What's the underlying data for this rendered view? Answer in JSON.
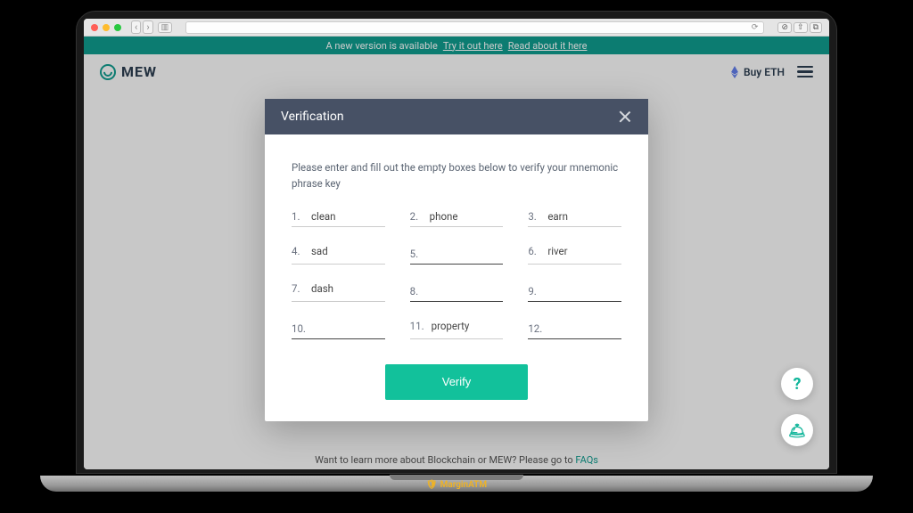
{
  "domain": "Computer-Use",
  "browser": {
    "reader_hint": "⤢"
  },
  "banner": {
    "text": "A new version is available",
    "link1": "Try it out here",
    "link2": "Read about it here"
  },
  "header": {
    "logo_text": "MEW",
    "buy_eth": "Buy ETH"
  },
  "modal": {
    "title": "Verification",
    "instruction": "Please enter and fill out the empty boxes below to verify your mnemonic phrase key",
    "words": [
      {
        "n": "1.",
        "v": "clean",
        "dark": false
      },
      {
        "n": "2.",
        "v": "phone",
        "dark": false
      },
      {
        "n": "3.",
        "v": "earn",
        "dark": false
      },
      {
        "n": "4.",
        "v": "sad",
        "dark": false
      },
      {
        "n": "5.",
        "v": "",
        "dark": true
      },
      {
        "n": "6.",
        "v": "river",
        "dark": false
      },
      {
        "n": "7.",
        "v": "dash",
        "dark": false
      },
      {
        "n": "8.",
        "v": "",
        "dark": true
      },
      {
        "n": "9.",
        "v": "",
        "dark": true
      },
      {
        "n": "10.",
        "v": "",
        "dark": true
      },
      {
        "n": "11.",
        "v": "property",
        "dark": false
      },
      {
        "n": "12.",
        "v": "",
        "dark": true
      }
    ],
    "verify_label": "Verify"
  },
  "footer": {
    "text": "Want to learn more about Blockchain or MEW? Please go to ",
    "link": "FAQs"
  },
  "fab": {
    "help": "?",
    "bell": "🛎"
  },
  "watermark": {
    "icon": "🛡",
    "text": "MarginATM"
  }
}
